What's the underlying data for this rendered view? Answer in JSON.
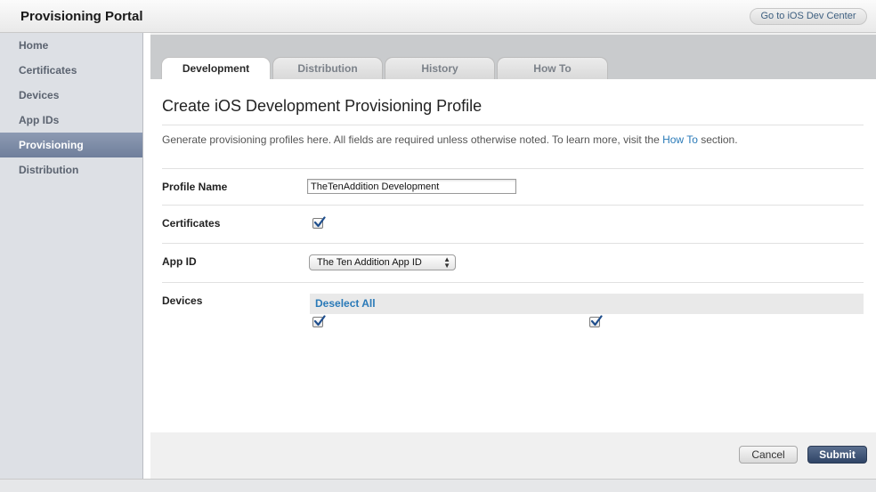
{
  "header": {
    "title": "Provisioning Portal",
    "dev_center_label": "Go to iOS Dev Center"
  },
  "sidebar": {
    "items": [
      {
        "label": "Home"
      },
      {
        "label": "Certificates"
      },
      {
        "label": "Devices"
      },
      {
        "label": "App IDs"
      },
      {
        "label": "Provisioning",
        "active": true
      },
      {
        "label": "Distribution"
      }
    ]
  },
  "tabs": [
    {
      "label": "Development",
      "active": true
    },
    {
      "label": "Distribution"
    },
    {
      "label": "History"
    },
    {
      "label": "How To"
    }
  ],
  "form": {
    "heading": "Create iOS Development Provisioning Profile",
    "intro_text": "Generate provisioning profiles here. All fields are required unless otherwise noted. To learn more, visit the ",
    "intro_link": "How To",
    "intro_suffix": " section.",
    "profile_name_label": "Profile Name",
    "profile_name_value": "TheTenAddition Development",
    "certificates_label": "Certificates",
    "app_id_label": "App ID",
    "app_id_value": "The Ten Addition App ID",
    "devices_label": "Devices",
    "deselect_all": "Deselect All"
  },
  "actions": {
    "cancel_label": "Cancel",
    "submit_label": "Submit"
  },
  "colors": {
    "accent_link": "#2a7ab8",
    "sidebar_active": "#7a88a3",
    "submit_button": "#3b5072"
  }
}
